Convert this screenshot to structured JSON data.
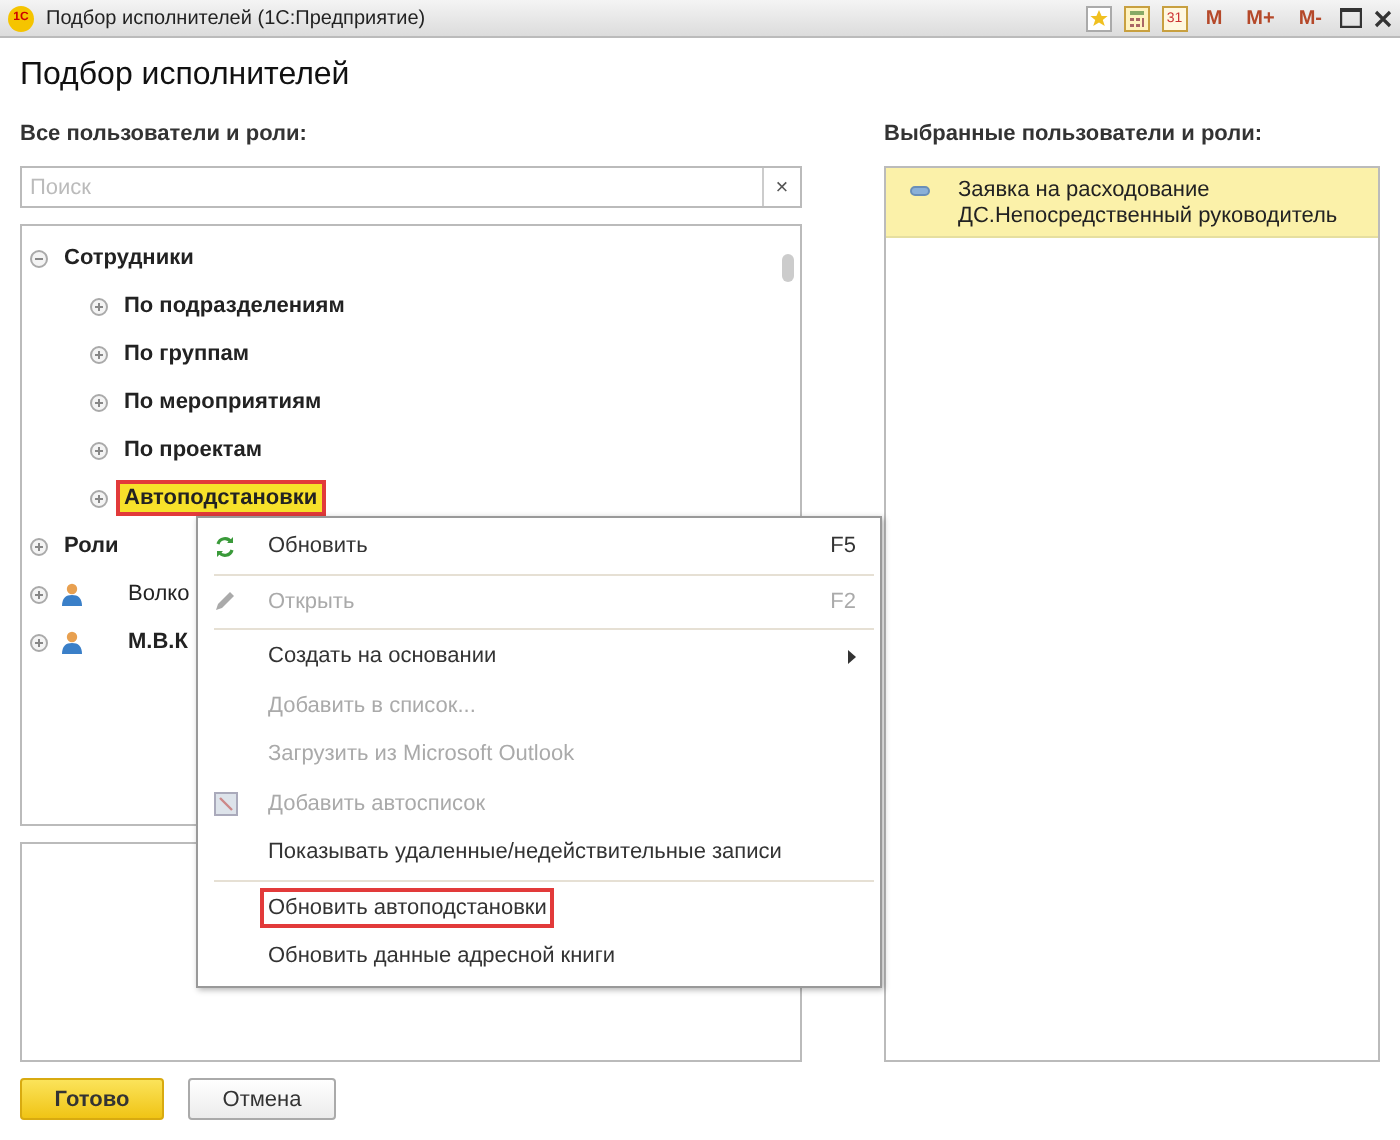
{
  "window": {
    "title": "Подбор исполнителей  (1С:Предприятие)",
    "logo": "1С",
    "toolbar": [
      {
        "kind": "star"
      },
      {
        "kind": "calculator"
      },
      {
        "kind": "calendar",
        "text": "31"
      },
      {
        "kind": "text",
        "text": "M"
      },
      {
        "kind": "text",
        "text": "M+"
      },
      {
        "kind": "text",
        "text": "M-"
      },
      {
        "kind": "maximize"
      },
      {
        "kind": "close"
      }
    ]
  },
  "heading": "Подбор исполнителей",
  "left": {
    "label": "Все пользователи и роли:",
    "search": {
      "placeholder": "Поиск",
      "clear": "×"
    },
    "tree": [
      {
        "label": "Сотрудники",
        "bold": true,
        "expanded": true,
        "selected": false,
        "children": [
          {
            "label": "По подразделениям",
            "bold": true,
            "expanded": false,
            "selected": false
          },
          {
            "label": "По группам",
            "bold": true,
            "expanded": false,
            "selected": false
          },
          {
            "label": "По мероприятиям",
            "bold": true,
            "expanded": false,
            "selected": false
          },
          {
            "label": "По проектам",
            "bold": true,
            "expanded": false,
            "selected": false
          },
          {
            "label": "Автоподстановки",
            "bold": true,
            "expanded": false,
            "selected": true
          }
        ]
      },
      {
        "label": "Роли",
        "bold": true,
        "expanded": false,
        "selected": false
      },
      {
        "label": "Волко",
        "bold": false,
        "expanded": false,
        "selected": false,
        "kind": "user"
      },
      {
        "label": "М.В.К",
        "bold": true,
        "expanded": false,
        "selected": false,
        "kind": "user"
      }
    ]
  },
  "right": {
    "label": "Выбранные пользователи и роли:",
    "items": [
      {
        "text": "Заявка на расходование ДС.Непосредственный руководитель",
        "selected": true
      }
    ]
  },
  "context_menu": [
    {
      "kind": "item",
      "label": "Обновить",
      "shortcut": "F5",
      "disabled": false
    },
    {
      "kind": "separator"
    },
    {
      "kind": "item",
      "label": "Открыть",
      "shortcut": "F2",
      "disabled": true
    },
    {
      "kind": "separator"
    },
    {
      "kind": "item",
      "label": "Создать на основании",
      "submenu": true,
      "disabled": false
    },
    {
      "kind": "item",
      "label": "Добавить в список...",
      "disabled": true
    },
    {
      "kind": "item",
      "label": "Загрузить из Microsoft Outlook",
      "disabled": true
    },
    {
      "kind": "item",
      "label": "Добавить автосписок",
      "disabled": true
    },
    {
      "kind": "item",
      "label": "Показывать удаленные/недействительные записи",
      "disabled": false
    },
    {
      "kind": "separator"
    },
    {
      "kind": "item",
      "label": "Обновить автоподстановки",
      "disabled": false,
      "highlighted": true
    },
    {
      "kind": "item",
      "label": "Обновить данные адресной книги",
      "disabled": false
    }
  ],
  "buttons": [
    {
      "label": "Готово",
      "primary": true
    },
    {
      "label": "Отмена",
      "primary": false
    }
  ]
}
